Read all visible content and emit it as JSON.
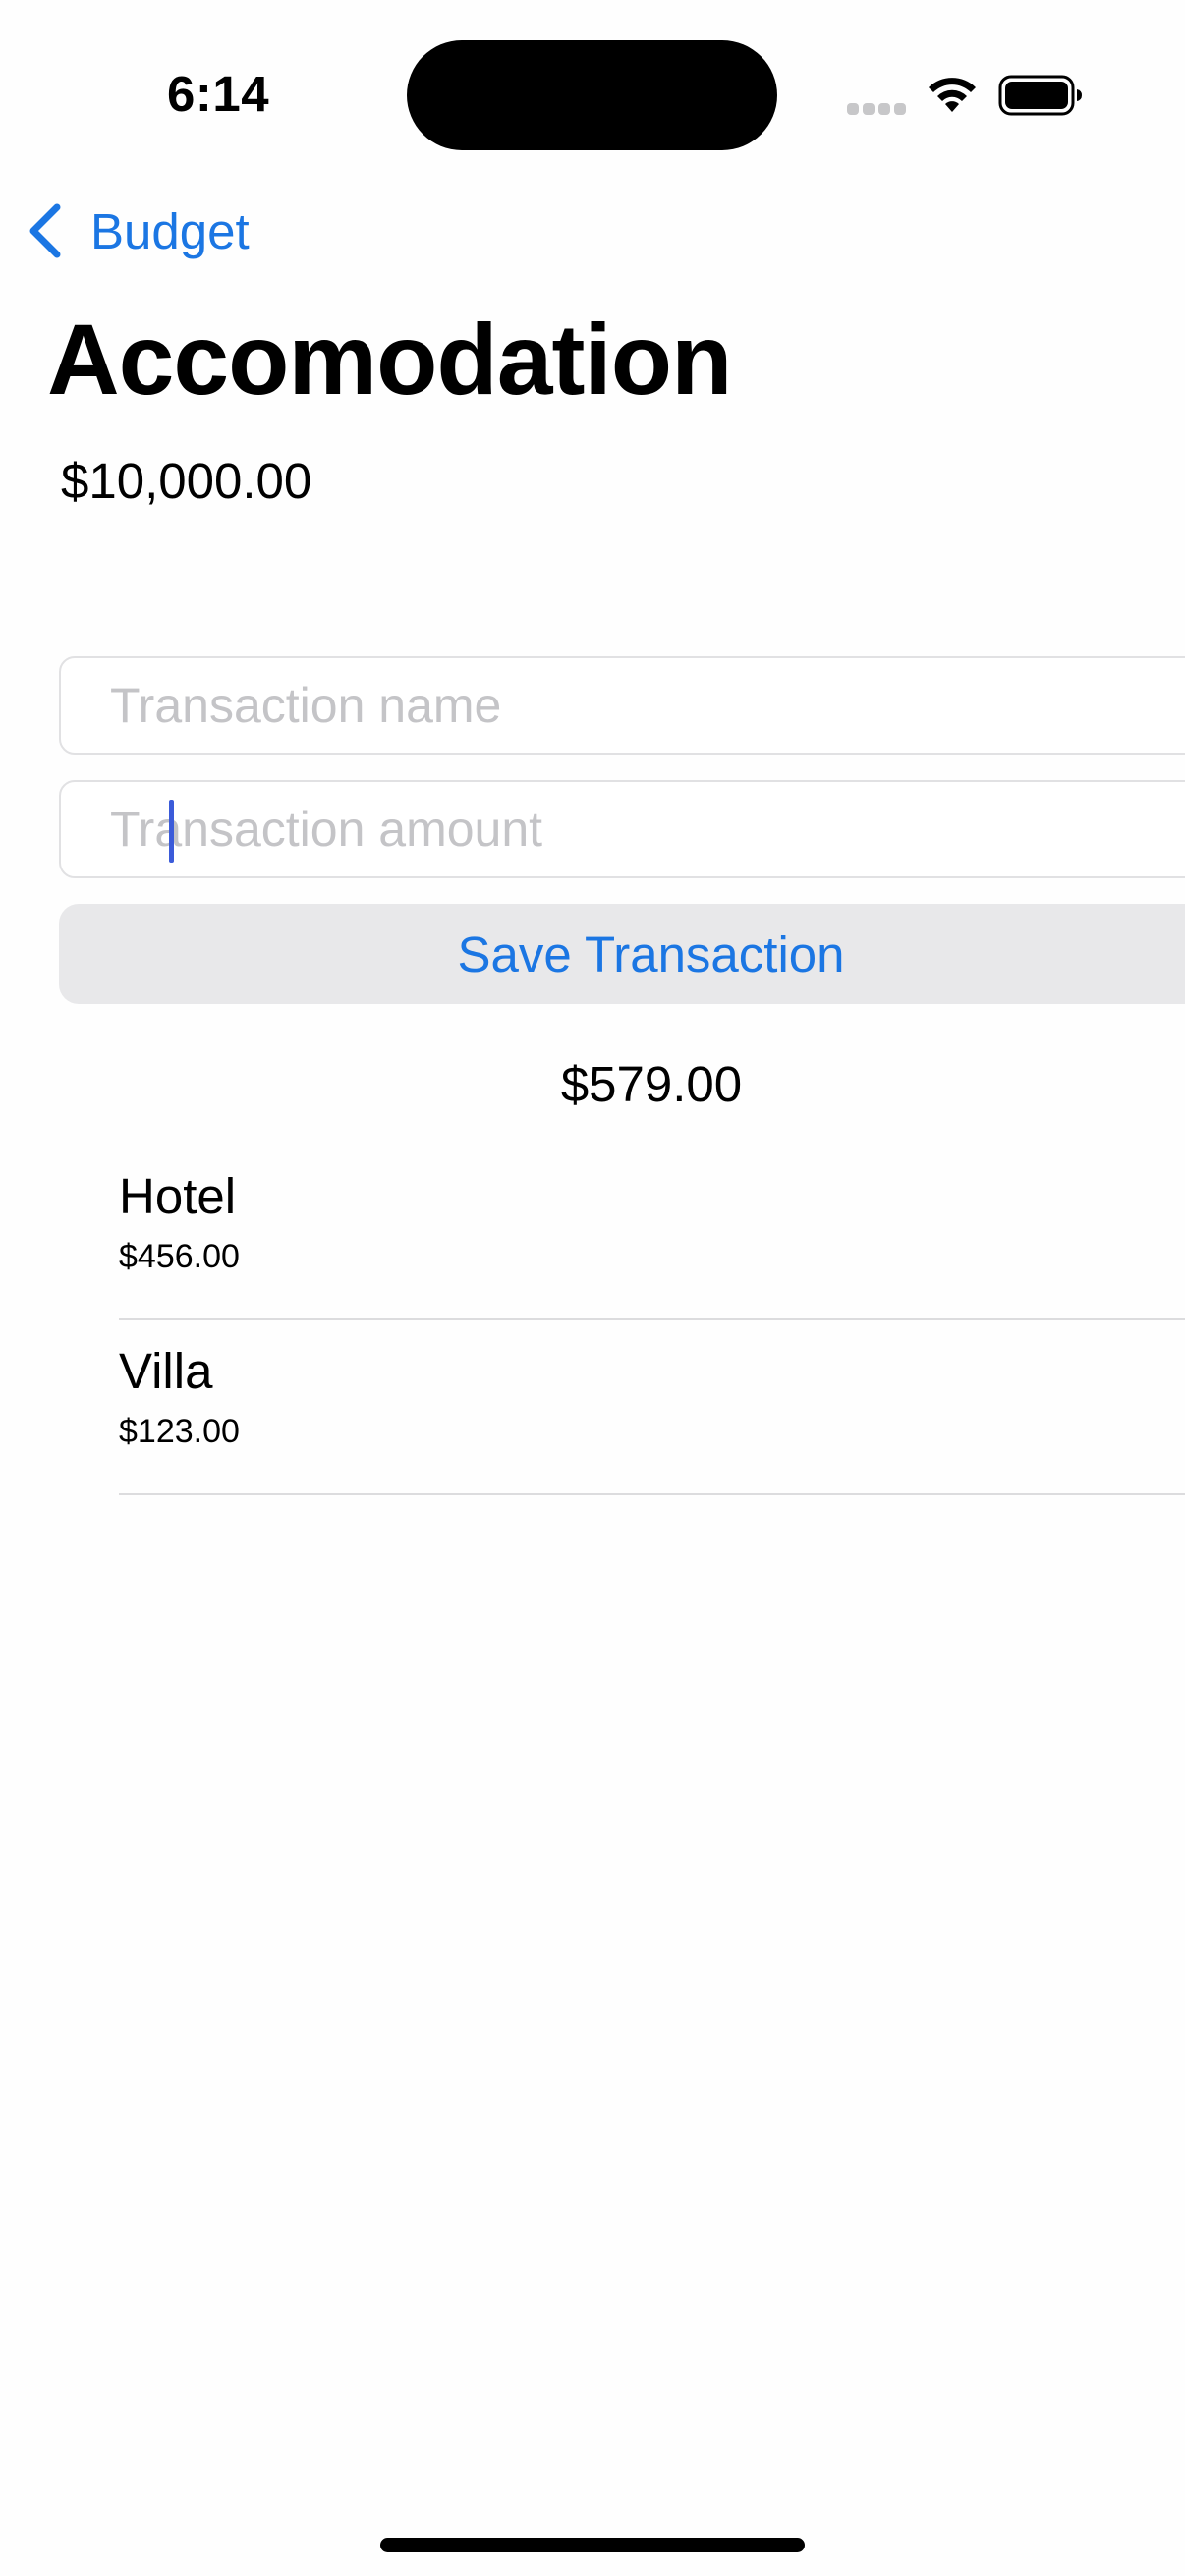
{
  "status_bar": {
    "time": "6:14"
  },
  "nav": {
    "back_label": "Budget",
    "accent_color": "#1b76e3"
  },
  "category": {
    "title": "Accomodation",
    "budget": "$10,000.00"
  },
  "form": {
    "name_placeholder": "Transaction name",
    "name_value": "",
    "amount_placeholder": "Transaction amount",
    "amount_value": "",
    "save_label": "Save Transaction"
  },
  "transactions_total": "$579.00",
  "transactions": [
    {
      "name": "Hotel",
      "amount": "$456.00"
    },
    {
      "name": "Villa",
      "amount": "$123.00"
    }
  ],
  "icons": {
    "back": "chevron-left-icon",
    "wifi": "wifi-icon",
    "battery": "battery-icon",
    "signal": "cellular-signal-icon"
  }
}
